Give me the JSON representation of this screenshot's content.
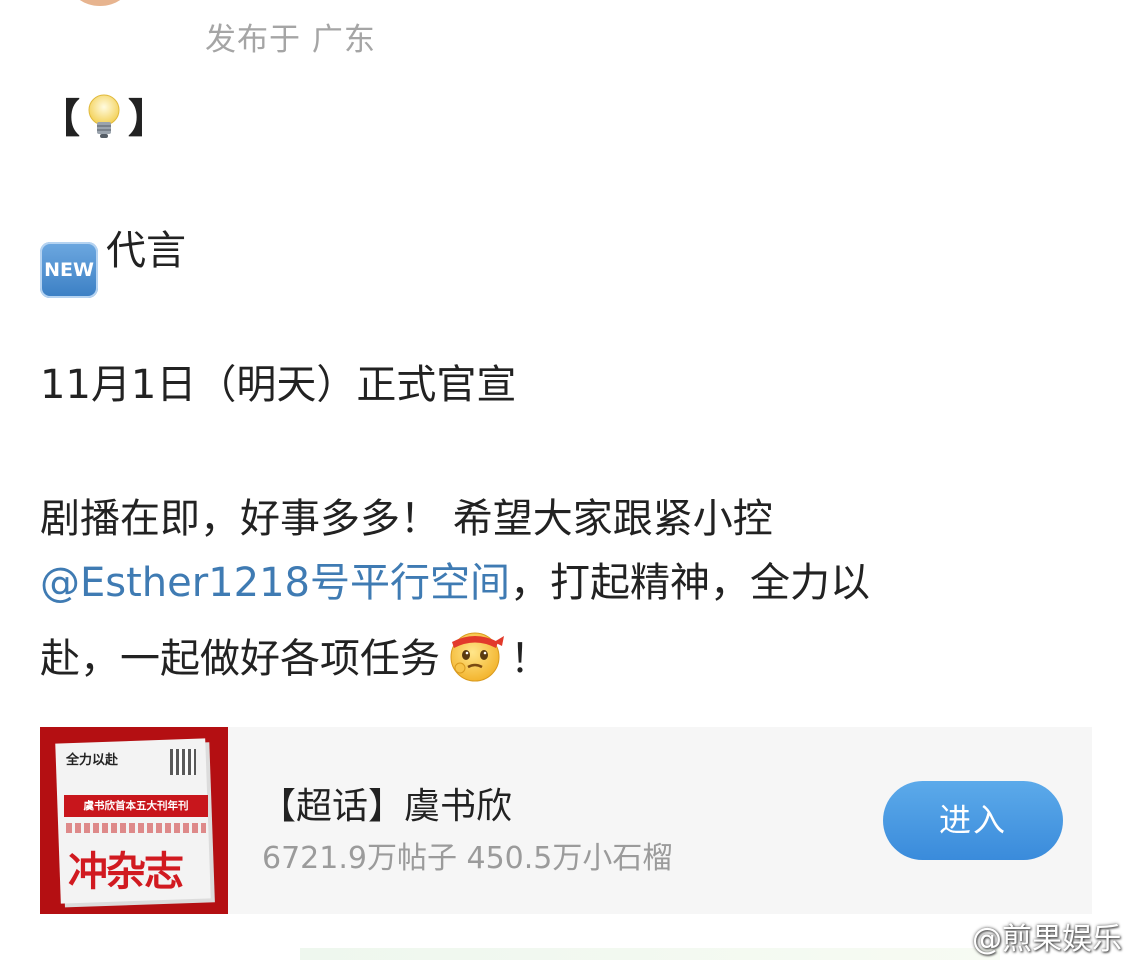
{
  "header": {
    "location": "发布于 广东"
  },
  "post": {
    "open_bracket": "【",
    "close_bracket": "】",
    "icons": {
      "bulb": "light-bulb-icon",
      "new": "new-badge-icon",
      "face": "determined-face-emoji-icon"
    },
    "new_badge_text": "NEW",
    "endorsement_label": "代言",
    "announcement": "11月1日（明天）正式官宣",
    "body_line1": "剧播在即，好事多多！ 希望大家跟紧小控",
    "mention": "@Esther1218号平行空间",
    "body_line2_rest": "，打起精神，全力以",
    "body_line3": "赴，一起做好各项任务",
    "body_line3_end": "！"
  },
  "card": {
    "cover_slogan": "全力以赴",
    "cover_band": "虞书欣首本五大刊年刊",
    "cover_title": "冲杂志",
    "title": "【超话】虞书欣",
    "stats": "6721.9万帖子 450.5万小石榴",
    "enter_label": "进入",
    "enter_color": "#3a8bdb"
  },
  "watermark": "@煎果娱乐"
}
